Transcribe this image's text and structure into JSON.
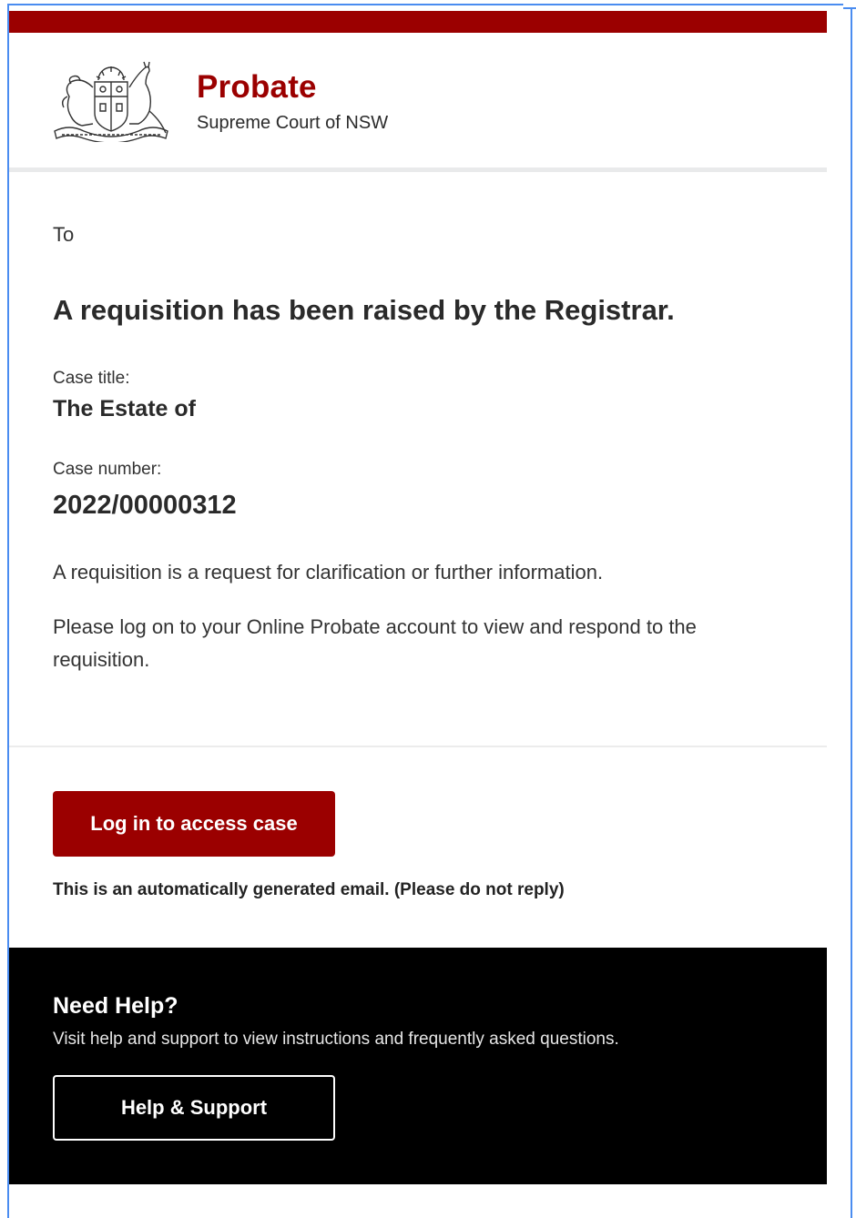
{
  "header": {
    "brand_title": "Probate",
    "brand_subtitle": "Supreme Court of NSW",
    "crest_icon": "nsw-coat-of-arms-icon"
  },
  "content": {
    "to_label": "To",
    "headline": "A requisition has been raised by the Registrar.",
    "case_title_label": "Case title:",
    "case_title_value": "The Estate of",
    "case_number_label": "Case number:",
    "case_number_value": "2022/00000312",
    "paragraph_1": "A requisition is a request for clarification or further information.",
    "paragraph_2": "Please log on to your Online Probate account to view and respond to the requisition."
  },
  "action": {
    "login_button_label": "Log in to access case",
    "auto_note": "This is an automatically generated email. (Please do not reply)"
  },
  "help": {
    "title": "Need Help?",
    "text": "Visit help and support to view instructions and frequently asked questions.",
    "button_label": "Help & Support"
  },
  "colors": {
    "brand_red": "#9b0000",
    "footer_black": "#000000",
    "frame_blue": "#4a8cf0"
  }
}
